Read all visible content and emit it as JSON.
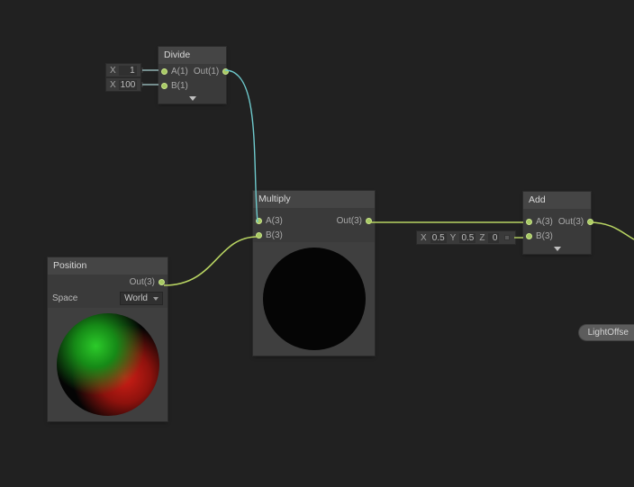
{
  "divide": {
    "title": "Divide",
    "in_a": "A(1)",
    "in_b": "B(1)",
    "out": "Out(1)",
    "lit_a_label": "X",
    "lit_a_value": "1",
    "lit_b_label": "X",
    "lit_b_value": "100"
  },
  "multiply": {
    "title": "Multiply",
    "in_a": "A(3)",
    "in_b": "B(3)",
    "out": "Out(3)"
  },
  "position": {
    "title": "Position",
    "out": "Out(3)",
    "space_label": "Space",
    "space_value": "World"
  },
  "add": {
    "title": "Add",
    "in_a": "A(3)",
    "in_b": "B(3)",
    "out": "Out(3)",
    "lit_x_label": "X",
    "lit_x_value": "0.5",
    "lit_y_label": "Y",
    "lit_y_value": "0.5",
    "lit_z_label": "Z",
    "lit_z_value": "0"
  },
  "pill": {
    "label": "LightOffse"
  }
}
